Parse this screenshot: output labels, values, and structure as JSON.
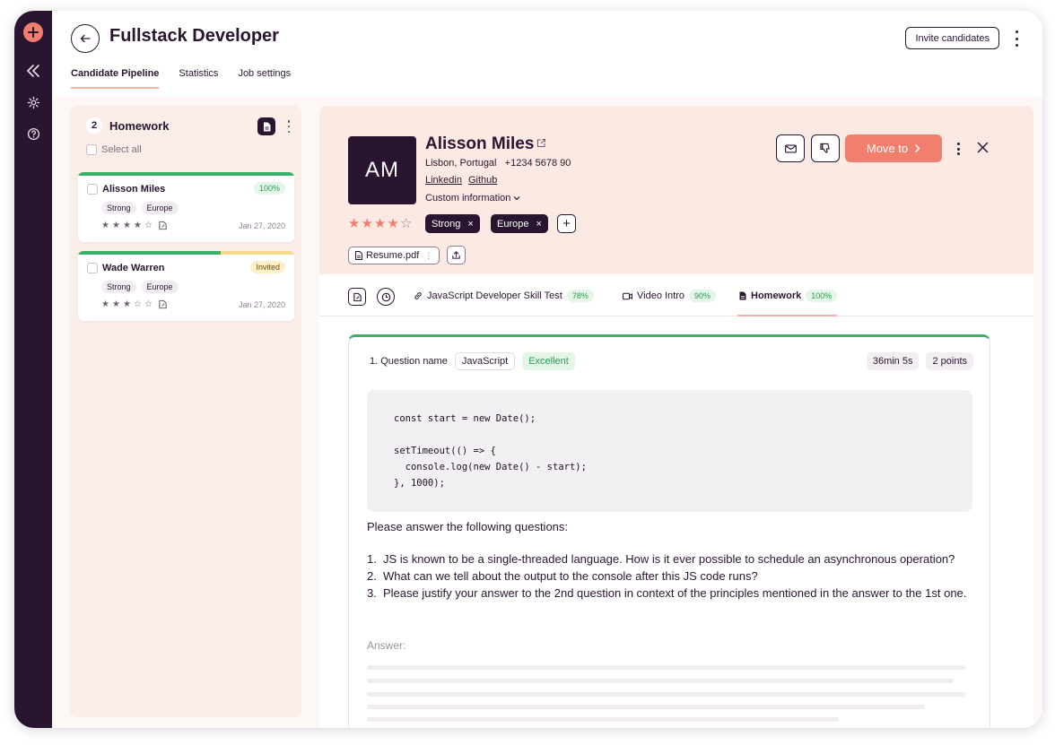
{
  "header": {
    "title": "Fullstack Developer",
    "invite_label": "Invite candidates",
    "tabs": [
      {
        "label": "Candidate Pipeline",
        "active": true
      },
      {
        "label": "Statistics",
        "active": false
      },
      {
        "label": "Job settings",
        "active": false
      }
    ]
  },
  "pipeline": {
    "column_count": "2",
    "column_title": "Homework",
    "select_all_label": "Select all",
    "cards": [
      {
        "name": "Alisson Miles",
        "badge": "100%",
        "tags": [
          "Strong",
          "Europe"
        ],
        "rating": 4,
        "date": "Jan 27, 2020"
      },
      {
        "name": "Wade Warren",
        "badge": "Invited",
        "tags": [
          "Strong",
          "Europe"
        ],
        "rating": 3,
        "date": "Jan 27, 2020"
      }
    ]
  },
  "candidate": {
    "initials": "AM",
    "name": "Alisson Miles",
    "location": "Lisbon, Portugal",
    "phone": "+1234 5678 90",
    "links": [
      "Linkedin",
      "Github"
    ],
    "custom_info_label": "Custom information",
    "rating": 4,
    "tags": [
      "Strong",
      "Europe"
    ],
    "resume_file": "Resume.pdf",
    "move_label": "Move to"
  },
  "detail_tabs": [
    {
      "label": "JavaScript Developer Skill Test",
      "pct": "78%",
      "icon": "link-icon"
    },
    {
      "label": "Video Intro",
      "pct": "90%",
      "icon": "video-icon"
    },
    {
      "label": "Homework",
      "pct": "100%",
      "icon": "document-icon",
      "active": true
    }
  ],
  "question": {
    "name": "1. Question name",
    "tag": "JavaScript",
    "grade": "Excellent",
    "time": "36min 5s",
    "points": "2 points",
    "code": "const start = new Date();\n\nsetTimeout(() => {\n  console.log(new Date() - start);\n}, 1000);",
    "intro": "Please answer the following questions:",
    "items": [
      "JS is known to be a single-threaded language. How is it ever possible to schedule an asynchronous operation?",
      "What can we tell about the output to the console after this JS code runs?",
      "Please justify your answer to the 2nd question in context of the principles mentioned in the answer to the 1st one."
    ],
    "answer_label": "Answer:"
  },
  "colors": {
    "primary": "#2a1530",
    "accent": "#f27f6e",
    "success": "#3bb069",
    "warning": "#f5c95a",
    "panel": "#fbeae3"
  }
}
